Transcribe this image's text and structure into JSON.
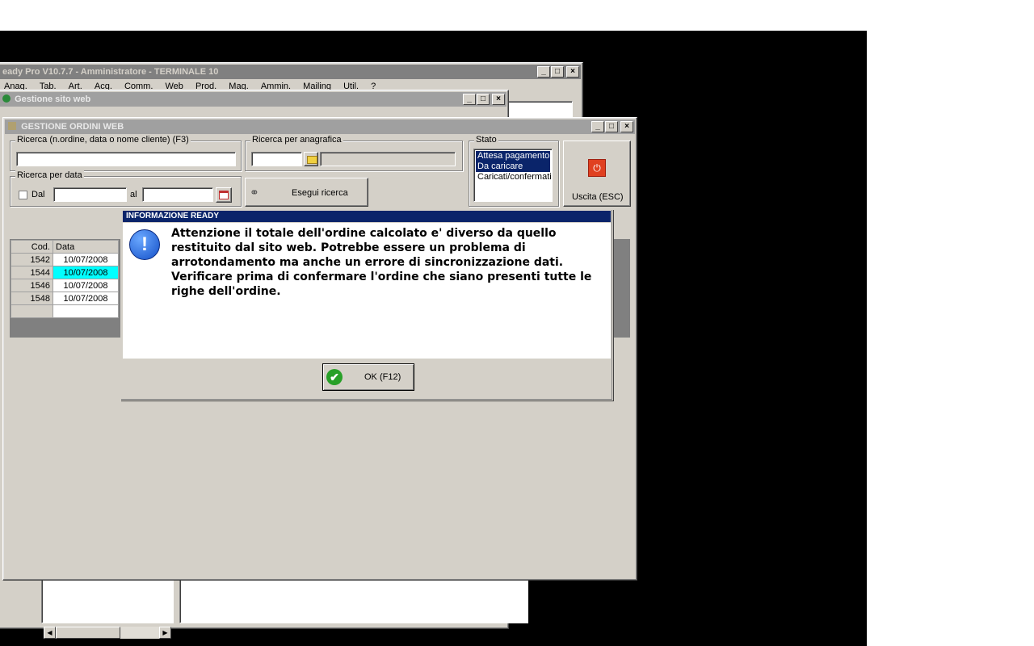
{
  "main_window": {
    "title": "eady Pro V10.7.7 - Amministratore - TERMINALE 10",
    "menu": [
      "Anag.",
      "Tab.",
      "Art.",
      "Acq.",
      "Comm.",
      "Web",
      "Prod.",
      "Mag.",
      "Ammin.",
      "Mailing",
      "Util.",
      "?"
    ]
  },
  "sito_window": {
    "title": "Gestione sito web"
  },
  "ordini_window": {
    "title": "GESTIONE ORDINI WEB",
    "search_group_label": "Ricerca (n.ordine, data o nome cliente) (F3)",
    "anagrafica_group_label": "Ricerca per anagrafica",
    "data_group_label": "Ricerca per data",
    "dal_label": "Dal",
    "al_label": "al",
    "esegui_label": "Esegui ricerca",
    "stato_group_label": "Stato",
    "stato_items": [
      "Attesa pagamento",
      "Da caricare",
      "Caricati/confermati"
    ],
    "uscita_label": "Uscita (ESC)",
    "grid_headers": [
      "Cod.",
      "Data"
    ],
    "grid_rows": [
      {
        "cod": "1542",
        "data": "10/07/2008"
      },
      {
        "cod": "1544",
        "data": "10/07/2008"
      },
      {
        "cod": "1546",
        "data": "10/07/2008"
      },
      {
        "cod": "1548",
        "data": "10/07/2008"
      }
    ]
  },
  "dialog": {
    "title": "INFORMAZIONE READY",
    "message_1": "Attenzione il totale dell'ordine calcolato e' diverso da quello restituito dal sito web. Potrebbe essere un problema di arrotondamento ma anche un errore di sincronizzazione dati.",
    "message_2": "Verificare prima di confermare l'ordine che siano presenti tutte le righe dell'ordine.",
    "ok_label": "OK (F12)"
  },
  "colors": {
    "title_active": "#0a246a",
    "selection_cyan": "#00ffff",
    "uscita_red": "#e04020"
  }
}
